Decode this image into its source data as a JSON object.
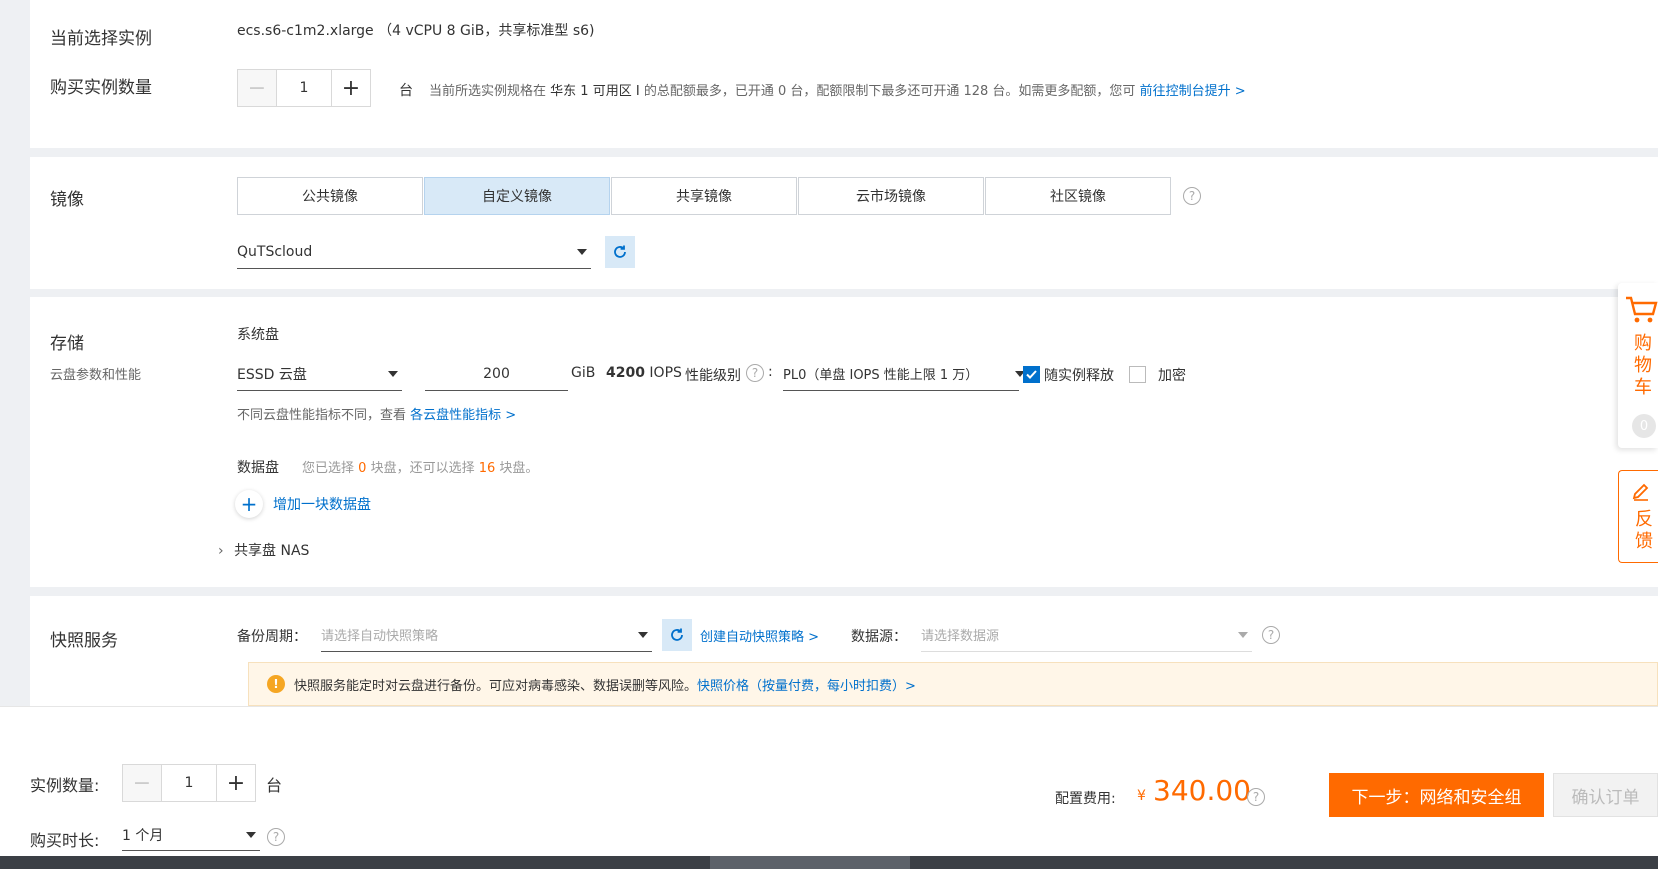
{
  "instance": {
    "section_label": "当前选择实例",
    "spec": "ecs.s6-c1m2.xlarge",
    "spec_detail": "（4 vCPU 8 GiB，共享标准型 s6)",
    "qty_label": "购买实例数量",
    "qty_value": "1",
    "qty_unit": "台",
    "quota_prefix": "当前所选实例规格在",
    "quota_zone": "华东 1 可用区 I",
    "quota_suffix": "的总配额最多，已开通 0 台，配额限制下最多还可开通 128 台。如需更多配额，您可",
    "quota_link": "前往控制台提升 >"
  },
  "image": {
    "section_label": "镜像",
    "tabs": [
      {
        "label": "公共镜像",
        "active": false
      },
      {
        "label": "自定义镜像",
        "active": true
      },
      {
        "label": "共享镜像",
        "active": false
      },
      {
        "label": "云市场镜像",
        "active": false
      },
      {
        "label": "社区镜像",
        "active": false
      }
    ],
    "selected": "QuTScloud"
  },
  "storage": {
    "section_label": "存储",
    "section_sub": "云盘参数和性能",
    "system_disk_label": "系统盘",
    "disk_type": "ESSD 云盘",
    "disk_size": "200",
    "disk_unit": "GiB",
    "iops": "4200",
    "iops_unit": "IOPS",
    "perf_label": "性能级别",
    "perf_level": "PL0（单盘 IOPS 性能上限 1 万）",
    "release_with_instance": "随实例释放",
    "release_checked": true,
    "encrypt": "加密",
    "encrypt_checked": false,
    "perf_note": "不同云盘性能指标不同，查看",
    "perf_link": "各云盘性能指标 >",
    "data_disk_label": "数据盘",
    "data_disk_note_a": "您已选择",
    "data_disk_selected": "0",
    "data_disk_note_b": "块盘，还可以选择",
    "data_disk_remaining": "16",
    "data_disk_note_c": "块盘。",
    "add_disk": "增加一块数据盘",
    "shared_disk": "共享盘 NAS"
  },
  "snapshot": {
    "section_label": "快照服务",
    "backup_label": "备份周期：",
    "backup_placeholder": "请选择自动快照策略",
    "create_link": "创建自动快照策略 >",
    "source_label": "数据源：",
    "source_placeholder": "请选择数据源",
    "notice_text": "快照服务能定时对云盘进行备份。可应对病毒感染、数据误删等风险。",
    "notice_link": "快照价格（按量付费，每小时扣费）>"
  },
  "footer": {
    "qty_label": "实例数量:",
    "qty_value": "1",
    "qty_unit": "台",
    "duration_label": "购买时长:",
    "duration_value": "1 个月",
    "fee_label": "配置费用:",
    "currency": "¥",
    "fee_value": "340.00",
    "next_button": "下一步：网络和安全组",
    "confirm_button": "确认订单"
  },
  "side": {
    "cart": "购物车",
    "cart_count": "0",
    "feedback": "反馈"
  },
  "colors": {
    "accent": "#ff6a00",
    "link": "#0070cc",
    "active_tab": "#d8e9f7"
  }
}
